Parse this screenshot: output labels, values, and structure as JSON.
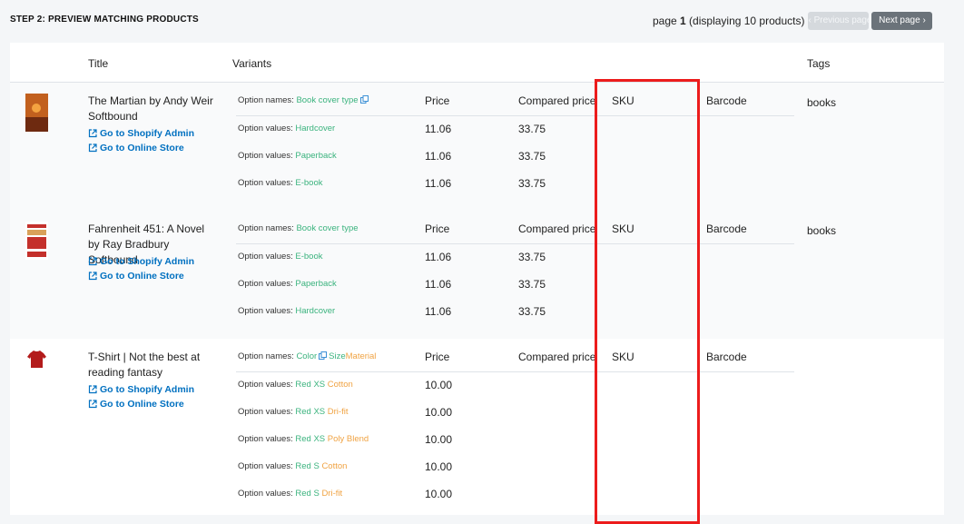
{
  "step_title": "STEP 2: PREVIEW MATCHING PRODUCTS",
  "pagination": {
    "page_prefix": "page ",
    "page_number": "1",
    "displaying": " (displaying 10 products)",
    "previous_label": "Previous page",
    "next_label": "Next page"
  },
  "columns": {
    "title": "Title",
    "variants": "Variants",
    "tags": "Tags"
  },
  "variant_columns": {
    "price": "Price",
    "compared": "Compared price",
    "sku": "SKU",
    "barcode": "Barcode"
  },
  "labels": {
    "option_names": "Option names:",
    "option_values": "Option values:",
    "admin_link": "Go to Shopify Admin",
    "store_link": "Go to Online Store"
  },
  "products": [
    {
      "title": "The Martian by Andy Weir Softbound",
      "tags": "books",
      "option_names": [
        "Book cover type"
      ],
      "variants": [
        {
          "values": [
            "Hardcover"
          ],
          "price": "11.06",
          "compared": "33.75"
        },
        {
          "values": [
            "Paperback"
          ],
          "price": "11.06",
          "compared": "33.75"
        },
        {
          "values": [
            "E-book"
          ],
          "price": "11.06",
          "compared": "33.75"
        }
      ]
    },
    {
      "title": "Fahrenheit 451: A Novel by Ray Bradbury Softbound",
      "tags": "books",
      "option_names": [
        "Book cover type"
      ],
      "variants": [
        {
          "values": [
            "E-book"
          ],
          "price": "11.06",
          "compared": "33.75"
        },
        {
          "values": [
            "Paperback"
          ],
          "price": "11.06",
          "compared": "33.75"
        },
        {
          "values": [
            "Hardcover"
          ],
          "price": "11.06",
          "compared": "33.75"
        }
      ]
    },
    {
      "title": "T-Shirt | Not the best at reading fantasy",
      "tags": "",
      "option_names": [
        "Color",
        "Size",
        "Material"
      ],
      "variants": [
        {
          "values": [
            "Red",
            "XS",
            "Cotton"
          ],
          "price": "10.00"
        },
        {
          "values": [
            "Red",
            "XS",
            "Dri-fit"
          ],
          "price": "10.00"
        },
        {
          "values": [
            "Red",
            "XS",
            "Poly Blend"
          ],
          "price": "10.00"
        },
        {
          "values": [
            "Red",
            "S",
            "Cotton"
          ],
          "price": "10.00"
        },
        {
          "values": [
            "Red",
            "S",
            "Dri-fit"
          ],
          "price": "10.00"
        }
      ]
    }
  ],
  "colors": {
    "link": "#0070c0",
    "green": "#3bb37e",
    "orange": "#f0a343",
    "highlight": "#ec1c1c"
  }
}
